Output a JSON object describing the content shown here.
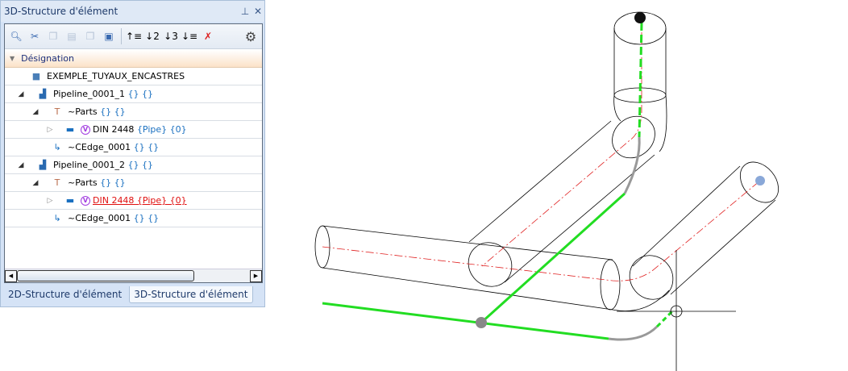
{
  "panel": {
    "title": "3D-Structure d'élément",
    "pin_icon": "pin-icon",
    "close_icon": "close-icon"
  },
  "toolbar": {
    "icons": [
      "find-icon",
      "cut-icon",
      "copy-icon",
      "paste-icon",
      "paste-special-icon",
      "clipboard-icon",
      "level-up-icon",
      "level-2-icon",
      "level-3-icon",
      "level-down-icon",
      "clear-filter-icon",
      "settings-icon"
    ]
  },
  "tree": {
    "header": "Désignation",
    "root": "EXEMPLE_TUYAUX_ENCASTRES",
    "rows": [
      {
        "name": "Pipeline_0001_1",
        "suffix": "{} {}"
      },
      {
        "name": "~Parts",
        "suffix": "{} {}"
      },
      {
        "name": "DIN 2448",
        "suffix": "{Pipe} {0}"
      },
      {
        "name": "~CEdge_0001",
        "suffix": "{} {}"
      },
      {
        "name": "Pipeline_0001_2",
        "suffix": "{} {}"
      },
      {
        "name": "~Parts",
        "suffix": "{} {}"
      },
      {
        "name": "DIN 2448 {Pipe} {0}"
      },
      {
        "name": "~CEdge_0001",
        "suffix": "{} {}"
      }
    ],
    "variant_badge": "V"
  },
  "tabs": [
    "2D-Structure d'élément",
    "3D-Structure d'élément"
  ],
  "colors": {
    "path": "#22dd22",
    "bend": "#999999",
    "centerline": "#e02020"
  }
}
